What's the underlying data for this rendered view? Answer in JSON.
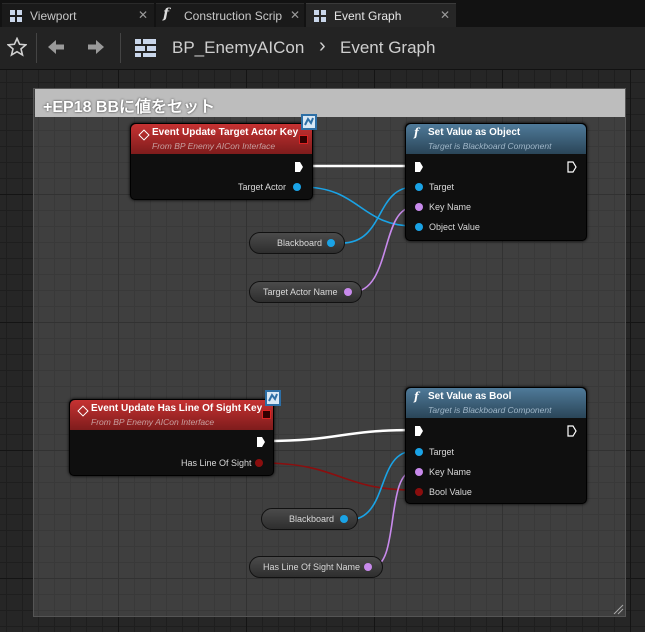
{
  "tabs": [
    {
      "label": "Viewport",
      "icon": "grid-icon"
    },
    {
      "label": "Construction Scrip",
      "icon": "function-icon"
    },
    {
      "label": "Event Graph",
      "icon": "grid-icon",
      "active": true
    }
  ],
  "breadcrumb": {
    "blueprint": "BP_EnemyAICon",
    "separator": "›",
    "graph": "Event Graph"
  },
  "comment": {
    "title": "+EP18 BBに値をセット"
  },
  "nodes": {
    "event_target": {
      "title": "Event Update Target Actor Key",
      "subtitle": "From BP Enemy AICon Interface",
      "pin_target_actor": "Target Actor"
    },
    "set_object": {
      "title": "Set Value as Object",
      "subtitle": "Target is Blackboard Component",
      "pin_target": "Target",
      "pin_key_name": "Key Name",
      "pin_value": "Object Value"
    },
    "blackboard_1": {
      "label": "Blackboard"
    },
    "target_actor_name": {
      "label": "Target Actor Name"
    },
    "event_los": {
      "title": "Event Update Has Line Of Sight Key",
      "subtitle": "From BP Enemy AICon Interface",
      "pin_los": "Has Line Of Sight"
    },
    "set_bool": {
      "title": "Set Value as Bool",
      "subtitle": "Target is Blackboard Component",
      "pin_target": "Target",
      "pin_key_name": "Key Name",
      "pin_value": "Bool Value"
    },
    "blackboard_2": {
      "label": "Blackboard"
    },
    "los_name": {
      "label": "Has Line Of Sight Name"
    }
  },
  "colors": {
    "exec": "#ffffff",
    "object_pin": "#1aa3e6",
    "name_pin": "#c88aec",
    "bool_pin": "#8b0e0e",
    "event_header": "#b32a2a",
    "function_header": "#3f6680"
  }
}
